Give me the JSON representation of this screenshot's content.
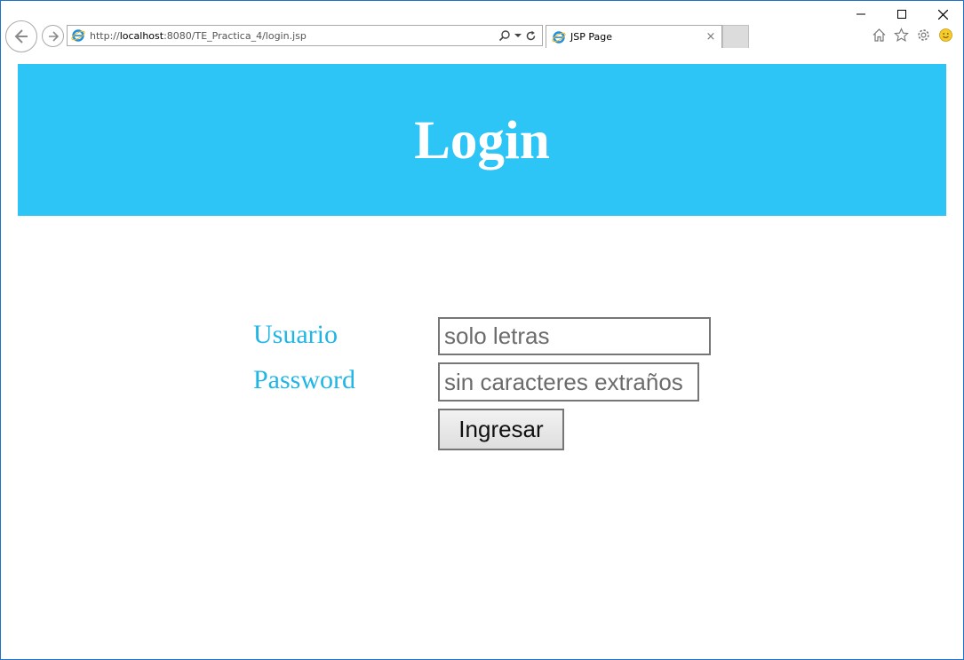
{
  "browser": {
    "url_prefix": "http://",
    "url_host": "localhost",
    "url_rest": ":8080/TE_Practica_4/login.jsp",
    "tab_title": "JSP Page",
    "tab_close": "×"
  },
  "page": {
    "title": "Login",
    "accent_color": "#2dc4f6",
    "label_color": "#1fb6e6"
  },
  "form": {
    "usuario_label": "Usuario",
    "usuario_placeholder": "solo letras",
    "password_label": "Password",
    "password_placeholder": "sin caracteres extraños",
    "submit_label": "Ingresar"
  }
}
